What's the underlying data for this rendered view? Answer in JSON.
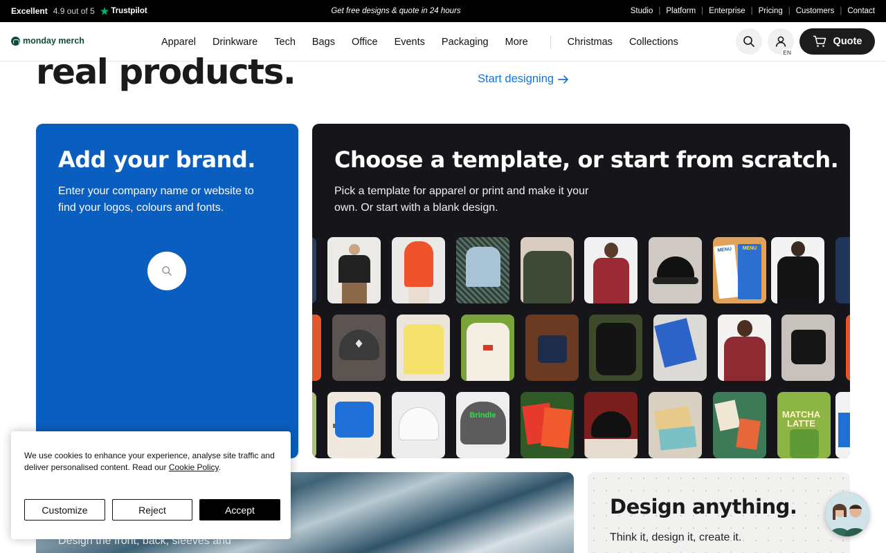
{
  "topbar": {
    "rating_word": "Excellent",
    "rating_text": "4.9 out of 5",
    "rating_brand": "Trustpilot",
    "promo": "Get free designs & quote in 24 hours",
    "links": [
      "Studio",
      "Platform",
      "Enterprise",
      "Pricing",
      "Customers",
      "Contact"
    ]
  },
  "nav": {
    "logo": "monday merch",
    "items": [
      "Apparel",
      "Drinkware",
      "Tech",
      "Bags",
      "Office",
      "Events",
      "Packaging",
      "More"
    ],
    "extra_items": [
      "Christmas",
      "Collections"
    ],
    "search_icon": "search-icon",
    "account_icon": "user-icon",
    "language": "EN",
    "quote_label": "Quote"
  },
  "hero": {
    "title": "real products.",
    "cta": "Start designing"
  },
  "brand_card": {
    "title": "Add your brand.",
    "text": "Enter your company name or website to find your logos, colours and fonts."
  },
  "template_card": {
    "title": "Choose a template, or start from scratch.",
    "text": "Pick a template for apparel or print and make it your own. Or start with a blank design.",
    "tile_print_texts": [
      "MENU",
      "MENU",
      "Brindle",
      "MATCHA LATTE"
    ]
  },
  "lower": {
    "photo_text": "Design the front, back, sleeves and",
    "design_title": "Design anything.",
    "design_text": "Think it, design it, create it."
  },
  "cookie": {
    "message": "We use cookies to enhance your experience, analyse site traffic and deliver personalised content. Read our",
    "policy_link": "Cookie Policy",
    "customize": "Customize",
    "reject": "Reject",
    "accept": "Accept"
  },
  "colors": {
    "brand_blue": "#0a5ebf",
    "dark_card": "#16161a",
    "link_blue": "#1673d6",
    "logo_green": "#0f4a3c",
    "trustpilot_green": "#00b67a"
  }
}
